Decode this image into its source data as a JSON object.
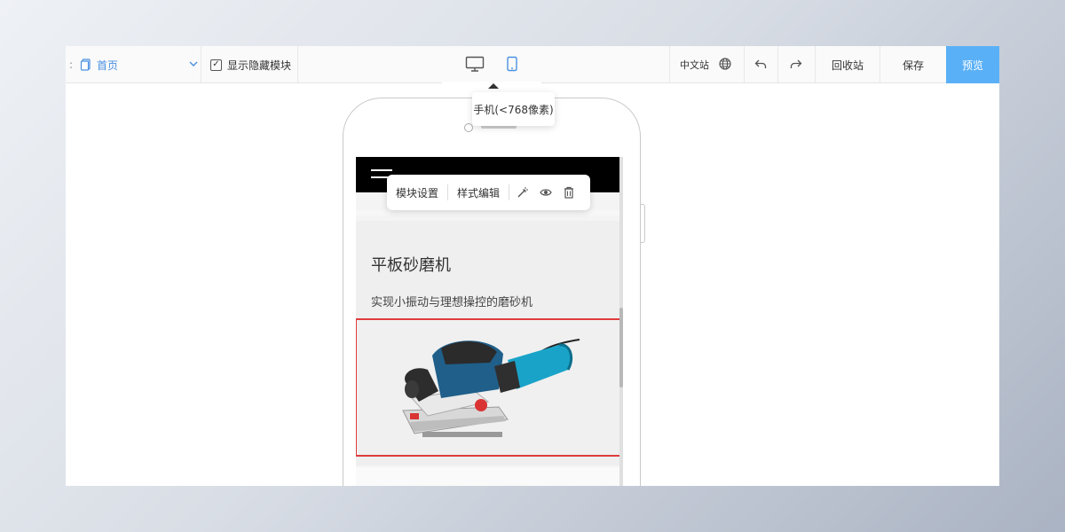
{
  "toolbar": {
    "page_select": {
      "label": "首页"
    },
    "show_hidden": {
      "label": "显示隐藏模块",
      "checked": true
    },
    "lang_label": "中文站",
    "recycle_label": "回收站",
    "save_label": "保存",
    "preview_label": "预览"
  },
  "device_tooltip": "手机(<768像素)",
  "module_toolbar": {
    "settings_label": "模块设置",
    "style_label": "样式编辑"
  },
  "product": {
    "title": "平板砂磨机",
    "subtitle": "实现小振动与理想操控的磨砂机"
  },
  "icons": {
    "page": "page-icon",
    "chevron": "chevron-down-icon",
    "desktop": "desktop-icon",
    "mobile": "mobile-icon",
    "globe": "globe-icon",
    "undo": "undo-icon",
    "redo": "redo-icon",
    "magic": "magic-wand-icon",
    "eye": "eye-icon",
    "trash": "trash-icon",
    "hamburger": "hamburger-menu-icon"
  },
  "colors": {
    "accent": "#4a90e2",
    "preview_bg": "#5ab0f7",
    "selection_border": "#e03c3c"
  }
}
